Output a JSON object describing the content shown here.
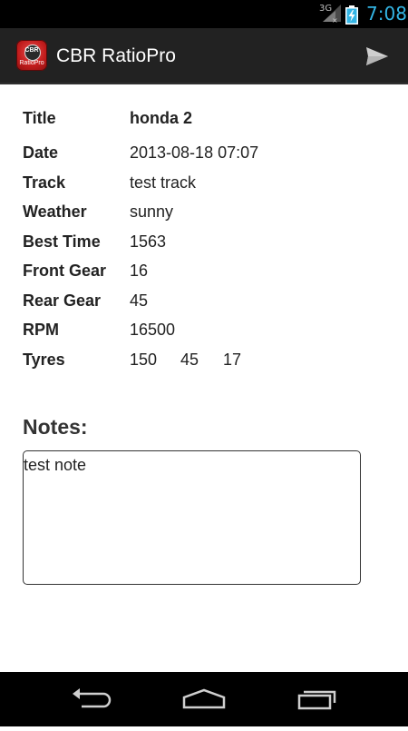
{
  "status_bar": {
    "network": "3G",
    "time": "7:08"
  },
  "app": {
    "title": "CBR RatioPro",
    "icon_text_top": "CBR",
    "icon_text_bottom": "RatioPro"
  },
  "details": [
    {
      "label": "Title",
      "value": "honda 2"
    },
    {
      "label": "Date",
      "value": "2013-08-18 07:07"
    },
    {
      "label": "Track",
      "value": "test track"
    },
    {
      "label": "Weather",
      "value": "sunny"
    },
    {
      "label": "Best Time",
      "value": "1563"
    },
    {
      "label": "Front Gear",
      "value": "16"
    },
    {
      "label": "Rear Gear",
      "value": "45"
    },
    {
      "label": "RPM",
      "value": "16500"
    }
  ],
  "tyres": {
    "label": "Tyres",
    "width": "150",
    "profile": "45",
    "rim": "17"
  },
  "notes": {
    "heading": "Notes:",
    "text": "test note"
  },
  "icons": {
    "send": "send-icon",
    "back": "back-icon",
    "home": "home-icon",
    "recents": "recent-apps-icon"
  },
  "colors": {
    "clock": "#33b5e5",
    "action_bar": "#222222",
    "app_icon": "#c31d1d"
  }
}
